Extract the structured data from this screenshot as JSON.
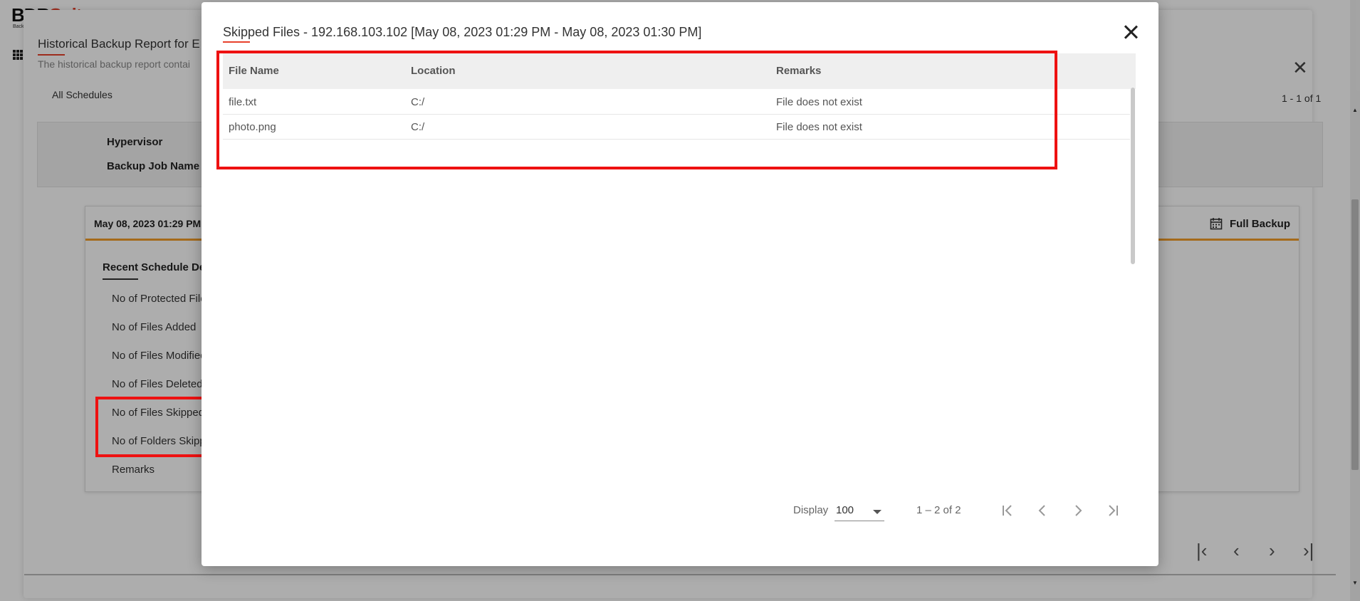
{
  "background": {
    "logo": {
      "main": "BDR",
      "accent": "Suite",
      "sub": "Backup"
    },
    "title": "Historical Backup Report for E",
    "subtitle": "The historical backup report contai",
    "tab": "All Schedules",
    "count": "1 - 1 of 1",
    "info_labels": [
      "Hypervisor",
      "Backup Job Name"
    ],
    "card": {
      "date": "May 08, 2023 01:29 PM",
      "type": "Full Backup",
      "section_title": "Recent Schedule Deta",
      "rows": [
        "No of Protected File",
        "No of Files Added",
        "No of Files Modified",
        "No of Files Deleted",
        "No of Files Skipped",
        "No of Folders Skipp",
        "Remarks"
      ]
    }
  },
  "dialog": {
    "title": "Skipped Files - 192.168.103.102 [May 08, 2023 01:29 PM - May 08, 2023 01:30 PM]",
    "columns": {
      "name": "File Name",
      "location": "Location",
      "remarks": "Remarks"
    },
    "rows": [
      {
        "name": "file.txt",
        "location": "C:/",
        "remarks": "File does not exist"
      },
      {
        "name": "photo.png",
        "location": "C:/",
        "remarks": "File does not exist"
      }
    ],
    "pager": {
      "display_label": "Display",
      "page_size": "100",
      "range": "1 – 2 of 2"
    }
  },
  "colors": {
    "accent": "#e8412c",
    "highlight": "#ee1111",
    "card_border": "#f39c28"
  }
}
